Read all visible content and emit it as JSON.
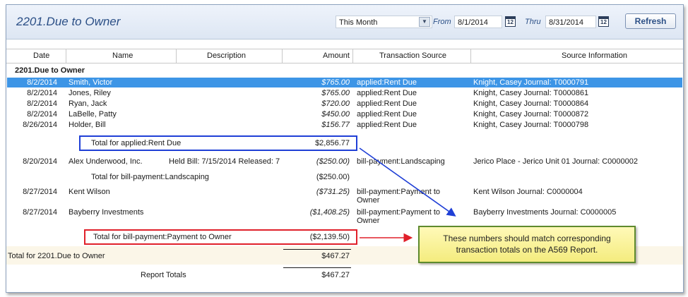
{
  "header": {
    "title": "2201.Due to Owner",
    "period": "This Month",
    "from_label": "From",
    "from_date": "8/1/2014",
    "thru_label": "Thru",
    "thru_date": "8/31/2014",
    "refresh_label": "Refresh"
  },
  "columns": [
    "Date",
    "Name",
    "Description",
    "Amount",
    "Transaction Source",
    "Source Information"
  ],
  "group_title": "2201.Due to Owner",
  "rows_applied": [
    {
      "date": "8/2/2014",
      "name": "Smith, Victor",
      "amount": "$765.00",
      "source": "applied:Rent Due",
      "info": "Knight, Casey Journal: T0000791"
    },
    {
      "date": "8/2/2014",
      "name": "Jones, Riley",
      "amount": "$765.00",
      "source": "applied:Rent Due",
      "info": "Knight, Casey Journal: T0000861"
    },
    {
      "date": "8/2/2014",
      "name": "Ryan, Jack",
      "amount": "$720.00",
      "source": "applied:Rent Due",
      "info": "Knight, Casey Journal: T0000864"
    },
    {
      "date": "8/2/2014",
      "name": "LaBelle, Patty",
      "amount": "$450.00",
      "source": "applied:Rent Due",
      "info": "Knight, Casey Journal: T0000872"
    },
    {
      "date": "8/26/2014",
      "name": "Holder, Bill",
      "amount": "$156.77",
      "source": "applied:Rent Due",
      "info": "Knight, Casey Journal: T0000798"
    }
  ],
  "total_applied": {
    "label": "Total for applied:Rent Due",
    "amount": "$2,856.77"
  },
  "row_landscaping": {
    "date": "8/20/2014",
    "name": "Alex Underwood, Inc.",
    "desc": "Held Bill: 7/15/2014 Released: 7",
    "amount": "($250.00)",
    "source": "bill-payment:Landscaping",
    "info": "Jerico Place - Jerico Unit 01 Journal: C0000002"
  },
  "total_landscaping": {
    "label": "Total for bill-payment:Landscaping",
    "amount": "($250.00)"
  },
  "rows_owner": [
    {
      "date": "8/27/2014",
      "name": "Kent Wilson",
      "amount": "($731.25)",
      "source1": "bill-payment:Payment to",
      "source2": "Owner",
      "info": "Kent Wilson Journal: C0000004"
    },
    {
      "date": "8/27/2014",
      "name": "Bayberry Investments",
      "amount": "($1,408.25)",
      "source1": "bill-payment:Payment to",
      "source2": "Owner",
      "info": "Bayberry Investments Journal: C0000005"
    }
  ],
  "total_owner": {
    "label": "Total for bill-payment:Payment to Owner",
    "amount": "($2,139.50)"
  },
  "total_group": {
    "label": "Total for 2201.Due to Owner",
    "amount": "$467.27"
  },
  "report_totals": {
    "label": "Report Totals",
    "amount": "$467.27"
  },
  "callout": {
    "line1": "These numbers should match corresponding",
    "line2": "transaction totals on the A569 Report."
  },
  "colors": {
    "selection": "#3d95e6",
    "title": "#2b4f86",
    "box_blue": "#1f3fd6",
    "box_red": "#e0202a",
    "callout_border": "#5e8a2e"
  },
  "icons": [
    "chevron-down-icon",
    "calendar-icon",
    "calendar-icon"
  ]
}
